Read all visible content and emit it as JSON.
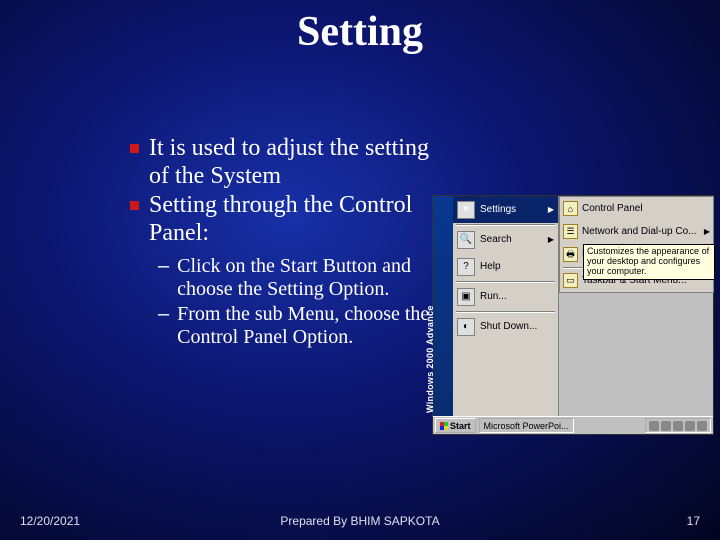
{
  "title": "Setting",
  "bullets": [
    "It is used to adjust the setting of the System",
    "Setting through the Control Panel:"
  ],
  "subbullets": [
    "Click on the Start Button and choose the Setting Option.",
    "From the sub Menu, choose the Control Panel Option."
  ],
  "footer": {
    "date": "12/20/2021",
    "prepared": "Prepared By BHIM SAPKOTA",
    "num": "17"
  },
  "screenshot": {
    "sidebar_label": "Windows 2000 Advance",
    "start_menu": [
      {
        "icon": "✶",
        "label": "Settings",
        "arrow": "▶",
        "selected": true
      },
      {
        "icon": "🔍",
        "label": "Search",
        "arrow": "▶",
        "selected": false
      },
      {
        "icon": "?",
        "label": "Help",
        "arrow": "",
        "selected": false
      },
      {
        "icon": "▣",
        "label": "Run...",
        "arrow": "",
        "selected": false
      },
      {
        "icon": "◐",
        "label": "Shut Down...",
        "arrow": "",
        "selected": false
      }
    ],
    "submenu": [
      {
        "icon": "⌂",
        "label": "Control Panel"
      },
      {
        "icon": "☰",
        "label": "Network and Dial-up Co..."
      },
      {
        "icon": "🖶",
        "label": "Printers"
      },
      {
        "icon": "▭",
        "label": "Taskbar & Start Menu..."
      }
    ],
    "tooltip": "Customizes the appearance of your desktop and configures your computer.",
    "taskbar": {
      "start": "Start",
      "task": "Microsoft PowerPoi..."
    }
  }
}
